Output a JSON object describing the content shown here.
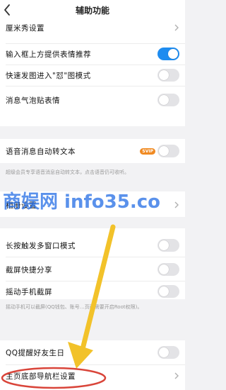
{
  "header": {
    "title": "辅助功能",
    "back_icon": "chevron-left-icon"
  },
  "group1": {
    "items": [
      {
        "label": "厘米秀设置",
        "control": "chevron"
      },
      {
        "label": "输入框上方提供表情推荐",
        "control": "toggle",
        "on": true
      },
      {
        "label": "快速发图进入\"怼\"图模式",
        "control": "toggle",
        "on": false
      },
      {
        "label": "消息气泡贴表情",
        "control": "toggle",
        "on": false
      }
    ]
  },
  "group2": {
    "items": [
      {
        "label": "语音消息自动转文本",
        "control": "toggle",
        "on": false,
        "badge": "SVIP"
      }
    ],
    "note": "超级会员专享语音消息自动转文本，点击语音仍可收听。"
  },
  "group3": {
    "items": [
      {
        "label": "相册设置",
        "control": "chevron"
      }
    ]
  },
  "group4": {
    "items": [
      {
        "label": "长按触发多窗口模式",
        "control": "toggle",
        "on": false
      },
      {
        "label": "截屏快捷分享",
        "control": "toggle",
        "on": false
      },
      {
        "label": "摇动手机截屏",
        "control": "toggle",
        "on": false
      }
    ],
    "note": "摇动手机可以截屏(QQ钱包、账号…页面需要开启Root权限)。"
  },
  "group5": {
    "items": [
      {
        "label": "QQ提醒好友生日",
        "control": "toggle",
        "on": false
      },
      {
        "label": "主页底部导航栏设置",
        "control": "chevron"
      }
    ]
  },
  "watermark": {
    "text": "商娱网 info35.co"
  },
  "colors": {
    "accent": "#1e8cf0",
    "svip": "#f08a22",
    "arrow": "#f2c22a",
    "highlight": "#d9453a"
  }
}
